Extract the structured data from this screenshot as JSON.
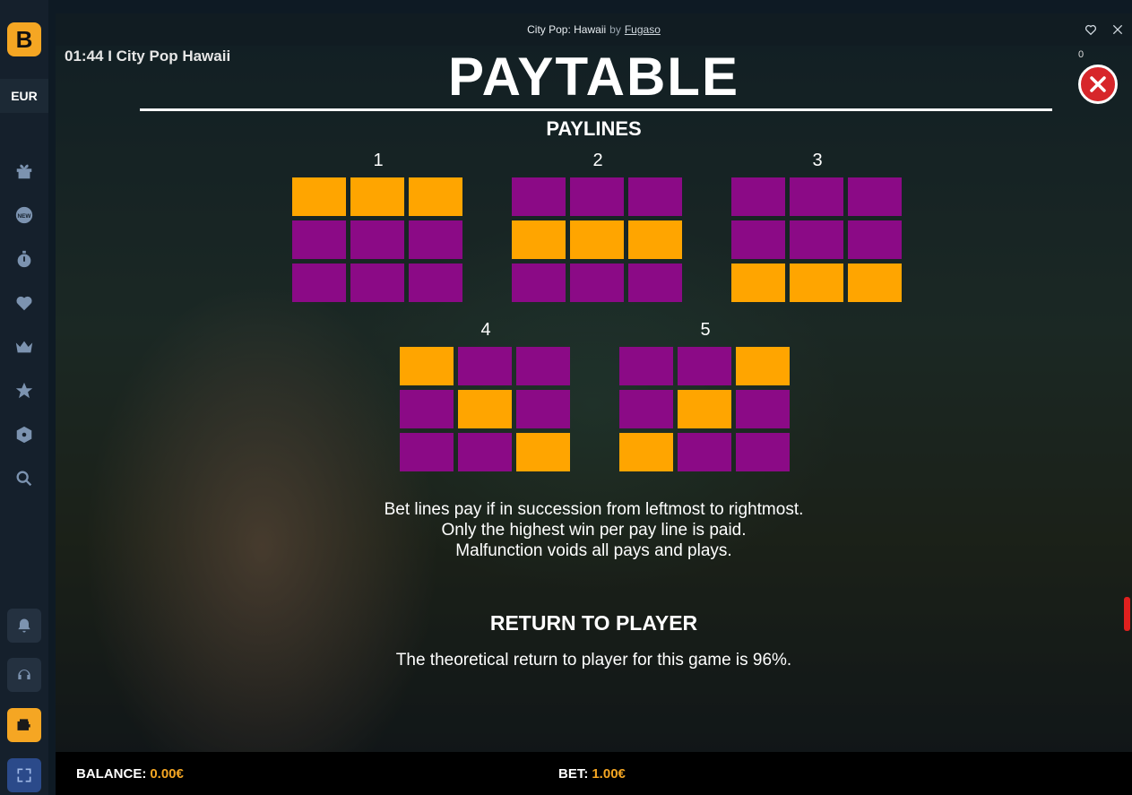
{
  "sidebar": {
    "currency": "EUR",
    "icons": [
      "gift-icon",
      "new-icon",
      "timer-icon",
      "heart-icon",
      "crown-icon",
      "star-icon",
      "dice-icon",
      "search-icon"
    ],
    "buttons": [
      "bell-icon",
      "headset-icon",
      "wallet-icon",
      "expand-icon"
    ],
    "accent": "#f5a623"
  },
  "window": {
    "game_title": "City Pop: Hawaii",
    "by": "by",
    "provider": "Fugaso"
  },
  "game": {
    "clock": "01:44 I City Pop Hawaii",
    "counter": "0",
    "paytable_title": "PAYTABLE",
    "paylines_title": "PAYLINES",
    "paylines": [
      {
        "num": "1",
        "rows": [
          [
            1,
            1,
            1
          ],
          [
            0,
            0,
            0
          ],
          [
            0,
            0,
            0
          ]
        ]
      },
      {
        "num": "2",
        "rows": [
          [
            0,
            0,
            0
          ],
          [
            1,
            1,
            1
          ],
          [
            0,
            0,
            0
          ]
        ]
      },
      {
        "num": "3",
        "rows": [
          [
            0,
            0,
            0
          ],
          [
            0,
            0,
            0
          ],
          [
            1,
            1,
            1
          ]
        ]
      },
      {
        "num": "4",
        "rows": [
          [
            1,
            0,
            0
          ],
          [
            0,
            1,
            0
          ],
          [
            0,
            0,
            1
          ]
        ]
      },
      {
        "num": "5",
        "rows": [
          [
            0,
            0,
            1
          ],
          [
            0,
            1,
            0
          ],
          [
            1,
            0,
            0
          ]
        ]
      }
    ],
    "colors": {
      "on": "#ffa500",
      "off": "#8b0a86"
    },
    "notes": [
      "Bet lines pay if in succession from leftmost to rightmost.",
      "Only the highest win per pay line is paid.",
      "Malfunction voids all pays and plays."
    ],
    "rtp_title": "RETURN TO PLAYER",
    "rtp_text": "The theoretical return to player for this game is 96%."
  },
  "footer": {
    "balance_label": "BALANCE:",
    "balance_value": "0.00€",
    "bet_label": "BET:",
    "bet_value": "1.00€"
  }
}
